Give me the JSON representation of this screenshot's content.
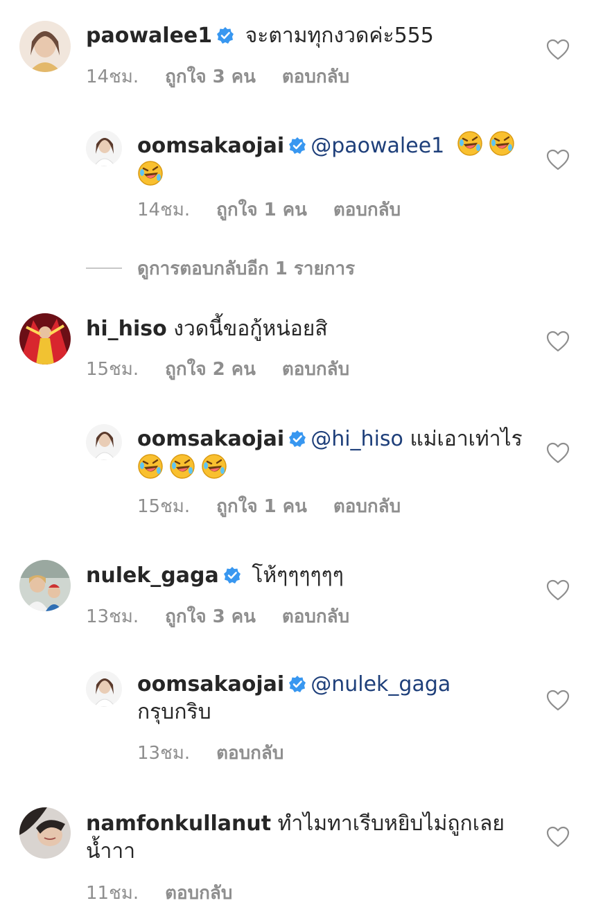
{
  "comments": [
    {
      "username": "paowalee1",
      "verified": true,
      "mention": "",
      "text": "จะตามทุกงวดค่ะ555",
      "emojis": 0,
      "time": "14ชม.",
      "likes": "ถูกใจ 3 คน",
      "reply": "ตอบกลับ"
    },
    {
      "username": "oomsakaojai",
      "verified": true,
      "mention": "@paowalee1",
      "text": "",
      "emojis": 3,
      "time": "14ชม.",
      "likes": "ถูกใจ 1 คน",
      "reply": "ตอบกลับ"
    },
    {
      "username": "hi_hiso",
      "verified": false,
      "mention": "",
      "text": "งวดนี้ขอกู้หน่อยสิ",
      "emojis": 0,
      "time": "15ชม.",
      "likes": "ถูกใจ 2 คน",
      "reply": "ตอบกลับ"
    },
    {
      "username": "oomsakaojai",
      "verified": true,
      "mention": "@hi_hiso",
      "text": "แม่เอาเท่าไร",
      "emojis": 3,
      "time": "15ชม.",
      "likes": "ถูกใจ 1 คน",
      "reply": "ตอบกลับ"
    },
    {
      "username": "nulek_gaga",
      "verified": true,
      "mention": "",
      "text": "โห้ๆๆๆๆๆๆ",
      "emojis": 0,
      "time": "13ชม.",
      "likes": "ถูกใจ 3 คน",
      "reply": "ตอบกลับ"
    },
    {
      "username": "oomsakaojai",
      "verified": true,
      "mention": "@nulek_gaga",
      "text": "กรุบกริบ",
      "emojis": 0,
      "time": "13ชม.",
      "likes": "",
      "reply": "ตอบกลับ"
    },
    {
      "username": "namfonkullanut",
      "verified": false,
      "mention": "",
      "text": "ทำไมทาเรีบหยิบไม่ถูกเลยน้ำาา",
      "emojis": 0,
      "time": "11ชม.",
      "likes": "",
      "reply": "ตอบกลับ"
    }
  ],
  "view_more_replies": "ดูการตอบกลับอีก 1 รายการ",
  "icons": {
    "verified": "verified-badge-icon",
    "like": "heart-outline-icon",
    "emoji": "rolling-on-floor-laughing-emoji"
  },
  "colors": {
    "verified": "#3897f0",
    "mention": "#1e3f7a",
    "meta": "#8e8e8e",
    "text": "#262626"
  }
}
